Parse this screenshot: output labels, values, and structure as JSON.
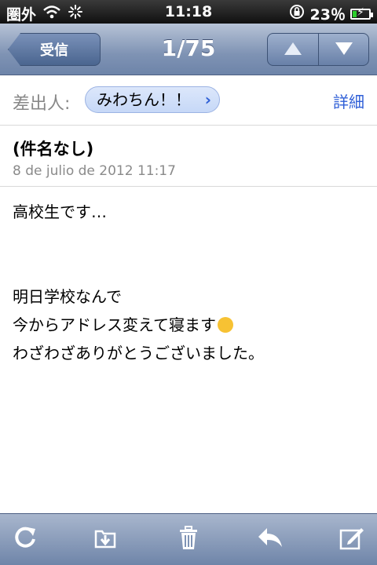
{
  "status": {
    "carrier": "圏外",
    "time": "11:18",
    "battery": "23％",
    "battery_level": 0.23
  },
  "nav": {
    "back_label": "受信",
    "title": "1/75"
  },
  "sender": {
    "label": "差出人:",
    "name": "みわちん！！",
    "details": "詳細"
  },
  "message": {
    "subject": "(件名なし)",
    "date": "8 de julio de 2012 11:17",
    "body": {
      "line1": "高校生です…",
      "line2": "明日学校なんで",
      "line3": "今からアドレス変えて寝ます",
      "line4": "わざわざありがとうございました。"
    }
  },
  "icons": {
    "wifi": "wifi-icon",
    "activity": "activity-spinner-icon",
    "lock": "rotation-lock-icon",
    "refresh": "refresh-icon",
    "move": "move-to-folder-icon",
    "trash": "trash-icon",
    "reply": "reply-icon",
    "compose": "compose-icon"
  },
  "colors": {
    "nav_bar": "#7f93b4",
    "link_blue": "#2f5fd7",
    "battery_green": "#2dcf2d"
  }
}
